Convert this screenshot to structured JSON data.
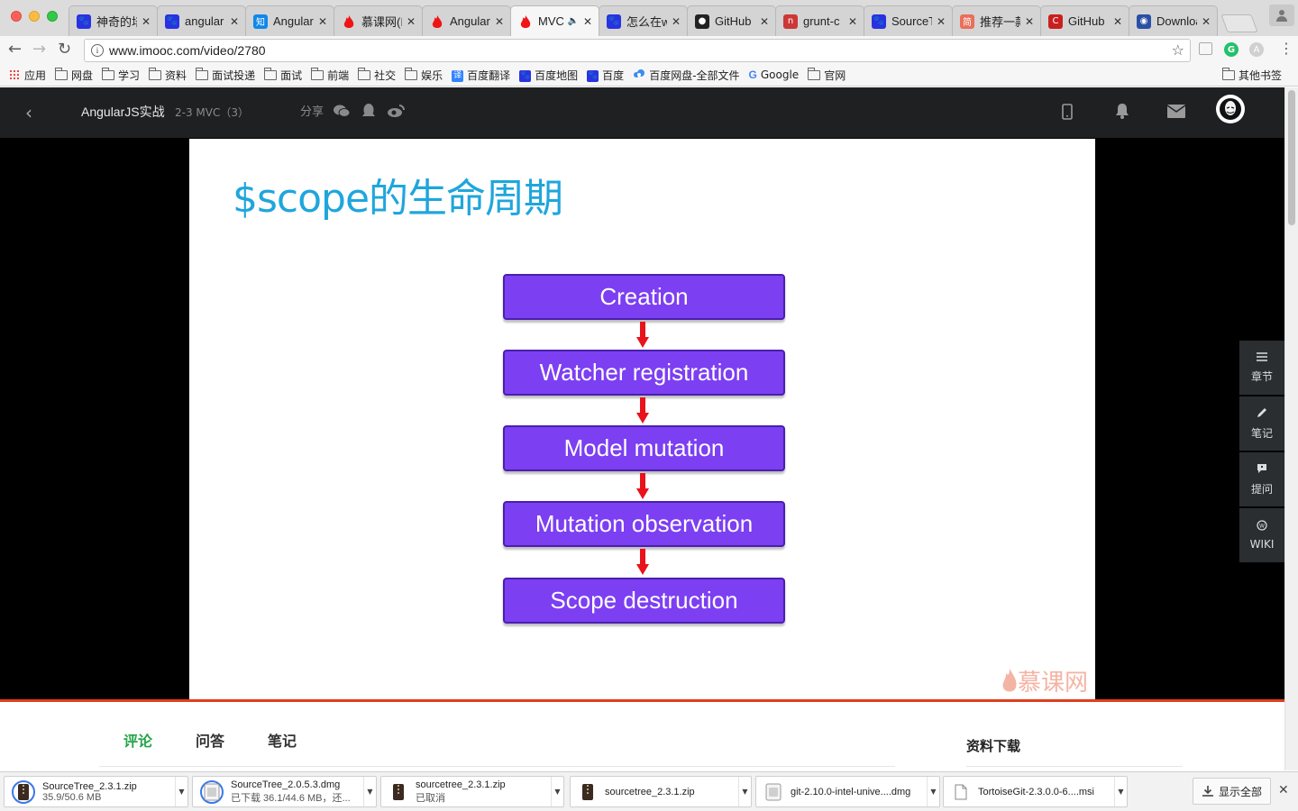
{
  "browser": {
    "tabs": [
      {
        "title": "神奇的培",
        "icon": "baidu-paw-icon",
        "color": "#2932e1"
      },
      {
        "title": "angular",
        "icon": "baidu-paw-icon",
        "color": "#2932e1"
      },
      {
        "title": "Angular",
        "icon": "zhihu-icon",
        "color": "#0f88eb"
      },
      {
        "title": "慕课网(I",
        "icon": "imooc-flame-icon",
        "color": "#f01414"
      },
      {
        "title": "Angular",
        "icon": "imooc-flame-icon",
        "color": "#f01414"
      },
      {
        "title": "MVC",
        "icon": "imooc-flame-icon",
        "color": "#f01414",
        "active": true
      },
      {
        "title": "怎么在w",
        "icon": "baidu-paw-icon",
        "color": "#2932e1"
      },
      {
        "title": "GitHub",
        "icon": "github-icon",
        "color": "#222222"
      },
      {
        "title": "grunt-c",
        "icon": "npm-icon",
        "color": "#cb3837"
      },
      {
        "title": "SourceT",
        "icon": "baidu-paw-icon",
        "color": "#2932e1"
      },
      {
        "title": "推荐一款",
        "icon": "jianshu-icon",
        "color": "#ea6f5a"
      },
      {
        "title": "GitHub",
        "icon": "csdn-icon",
        "color": "#c9201f"
      },
      {
        "title": "Downloa",
        "icon": "sourcetree-icon",
        "color": "#2a4fa5"
      }
    ],
    "url": "www.imooc.com/video/2780"
  },
  "bookmarks": {
    "apps_label": "应用",
    "items": [
      {
        "label": "网盘",
        "type": "folder"
      },
      {
        "label": "学习",
        "type": "folder"
      },
      {
        "label": "资料",
        "type": "folder"
      },
      {
        "label": "面试投递",
        "type": "folder"
      },
      {
        "label": "面试",
        "type": "folder"
      },
      {
        "label": "前端",
        "type": "folder"
      },
      {
        "label": "社交",
        "type": "folder"
      },
      {
        "label": "娱乐",
        "type": "folder"
      },
      {
        "label": "百度翻译",
        "type": "link",
        "icon": "translate-icon"
      },
      {
        "label": "百度地图",
        "type": "link",
        "icon": "baidu-paw-icon"
      },
      {
        "label": "百度",
        "type": "link",
        "icon": "baidu-paw-icon"
      },
      {
        "label": "百度网盘-全部文件",
        "type": "link",
        "icon": "baidu-cloud-icon"
      },
      {
        "label": "Google",
        "type": "link",
        "icon": "google-icon"
      },
      {
        "label": "官网",
        "type": "folder"
      }
    ],
    "other_label": "其他书签"
  },
  "header": {
    "course_title": "AngularJS实战",
    "chapter": "2-3 MVC（3）",
    "share_label": "分享"
  },
  "slide": {
    "title": "$scope的生命周期",
    "steps": [
      "Creation",
      "Watcher registration",
      "Model mutation",
      "Mutation observation",
      "Scope destruction"
    ],
    "watermark": "慕课网"
  },
  "player": {
    "progress_percent": 100
  },
  "sidetools": [
    {
      "label": "章节",
      "icon": "menu-icon"
    },
    {
      "label": "笔记",
      "icon": "pencil-icon"
    },
    {
      "label": "提问",
      "icon": "question-bubble-icon"
    },
    {
      "label": "WIKI",
      "icon": "wiki-icon"
    }
  ],
  "content": {
    "tabs": [
      "评论",
      "问答",
      "笔记"
    ],
    "active_tab": 0,
    "downloads_title": "资料下载"
  },
  "downloads": [
    {
      "name": "SourceTree_2.3.1.zip",
      "status": "35.9/50.6 MB"
    },
    {
      "name": "SourceTree_2.0.5.3.dmg",
      "status": "已下载 36.1/44.6 MB，还..."
    },
    {
      "name": "sourcetree_2.3.1.zip",
      "status": "已取消"
    },
    {
      "name": "sourcetree_2.3.1.zip",
      "status": ""
    },
    {
      "name": "git-2.10.0-intel-unive....dmg",
      "status": ""
    },
    {
      "name": "TortoiseGit-2.3.0.0-6....msi",
      "status": ""
    }
  ],
  "shelf": {
    "show_all_label": "显示全部"
  }
}
